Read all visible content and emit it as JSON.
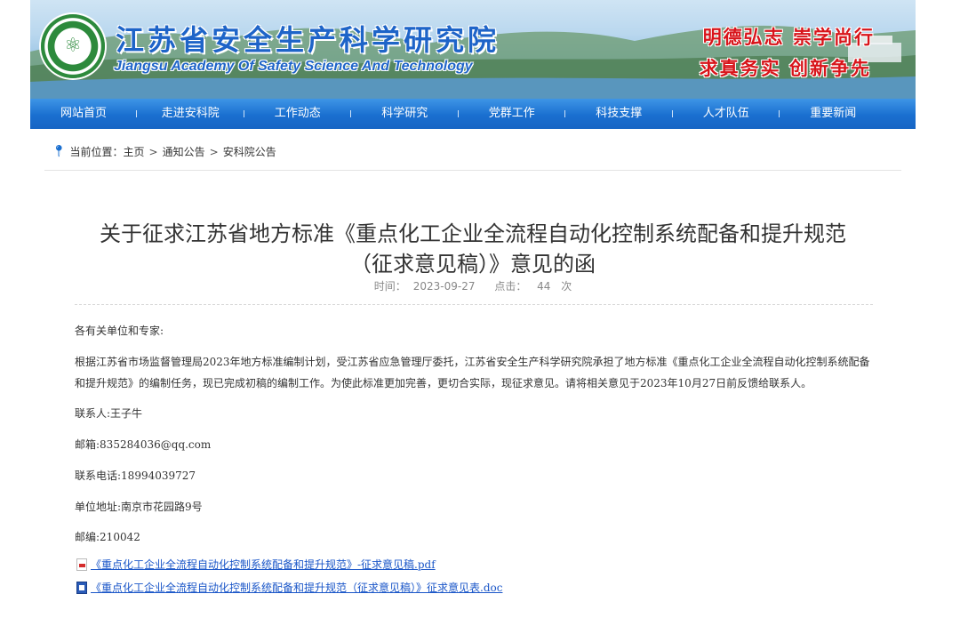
{
  "header": {
    "org_name_cn": "江苏省安全生产科学研究院",
    "org_name_en": "Jiangsu Academy Of Safety Science And Technology",
    "motto_line1": "明德弘志 崇学尚行",
    "motto_line2": "求真务实 创新争先"
  },
  "nav": {
    "items": [
      "网站首页",
      "走进安科院",
      "工作动态",
      "科学研究",
      "党群工作",
      "科技支撑",
      "人才队伍",
      "重要新闻"
    ]
  },
  "breadcrumb": {
    "label": "当前位置：",
    "items": [
      "主页",
      "通知公告",
      "安科院公告"
    ],
    "separator": ">"
  },
  "article": {
    "title_line1": "关于征求江苏省地方标准《重点化工企业全流程自动化控制系统配备和提升规范",
    "title_line2": "（征求意见稿）》意见的函",
    "time_label": "时间：",
    "time_value": "2023-09-27",
    "clicks_label": "点击：",
    "clicks_value": "44",
    "clicks_unit": "次",
    "greeting": "各有关单位和专家:",
    "main_text": "根据江苏省市场监督管理局2023年地方标准编制计划，受江苏省应急管理厅委托，江苏省安全生产科学研究院承担了地方标准《重点化工企业全流程自动化控制系统配备和提升规范》的编制任务，现已完成初稿的编制工作。为使此标准更加完善，更切合实际，现征求意见。请将相关意见于2023年10月27日前反馈给联系人。",
    "contact": "联系人:王子牛",
    "email": "邮箱:835284036@qq.com",
    "phone": "联系电话:18994039727",
    "address": "单位地址:南京市花园路9号",
    "zipcode": "邮编:210042",
    "attachments": [
      {
        "icon": "pdf-file-icon",
        "label": "《重点化工企业全流程自动化控制系统配备和提升规范》-征求意见稿.pdf"
      },
      {
        "icon": "word-doc-icon",
        "label": "《重点化工企业全流程自动化控制系统配备和提升规范（征求意见稿）》征求意见表.doc"
      }
    ]
  },
  "colors": {
    "nav_blue": "#1a6fd0",
    "title_blue": "#1e64c8",
    "motto_red": "#d8141a",
    "link_blue": "#1a56c8"
  }
}
